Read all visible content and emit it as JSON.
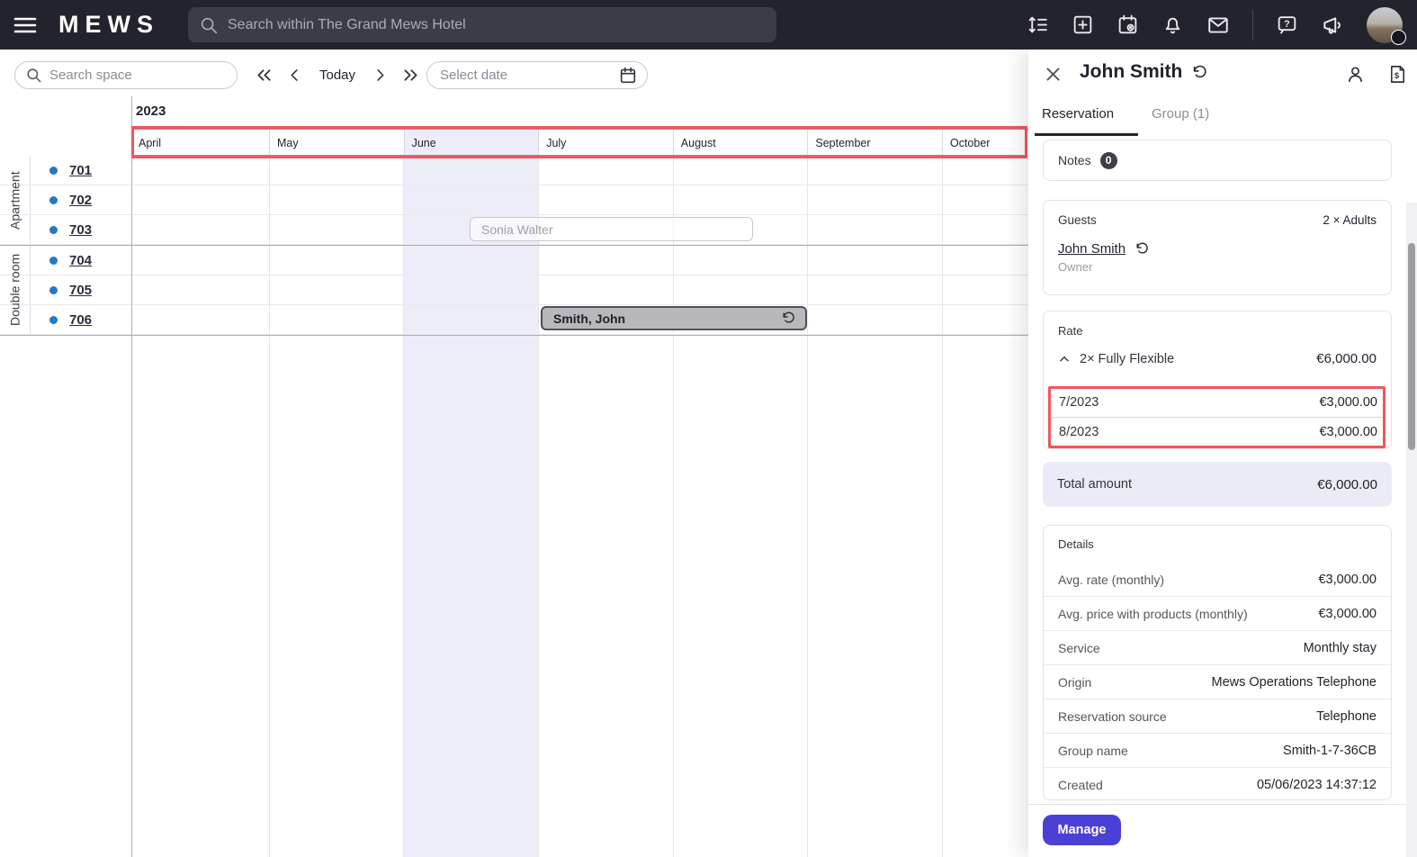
{
  "topbar": {
    "logo": "MEWS",
    "search_placeholder": "Search within The Grand Mews Hotel"
  },
  "toolbar": {
    "search_space_placeholder": "Search space",
    "today_label": "Today",
    "select_date_placeholder": "Select date"
  },
  "timeline": {
    "year": "2023",
    "months": [
      {
        "label": "April"
      },
      {
        "label": "May"
      },
      {
        "label": "June"
      },
      {
        "label": "July"
      },
      {
        "label": "August"
      },
      {
        "label": "September"
      },
      {
        "label": "October"
      }
    ],
    "groups": [
      {
        "label": "Apartment",
        "rooms": [
          {
            "number": "701"
          },
          {
            "number": "702"
          },
          {
            "number": "703"
          }
        ]
      },
      {
        "label": "Double room",
        "rooms": [
          {
            "number": "704"
          },
          {
            "number": "705"
          },
          {
            "number": "706"
          }
        ]
      }
    ],
    "reservations": [
      {
        "name": "Sonia Walter",
        "state": "ghost"
      },
      {
        "name": "Smith, John",
        "state": "selected"
      }
    ]
  },
  "panel": {
    "title": "John Smith",
    "tabs": {
      "reservation": "Reservation",
      "group": "Group (1)"
    },
    "notes": {
      "label": "Notes",
      "count": "0"
    },
    "guests": {
      "label": "Guests",
      "count_label": "2 × Adults",
      "owner_name": "John Smith",
      "owner_role": "Owner"
    },
    "rate": {
      "label": "Rate",
      "name": "2× Fully Flexible",
      "amount": "€6,000.00",
      "months": [
        {
          "period": "7/2023",
          "amount": "€3,000.00"
        },
        {
          "period": "8/2023",
          "amount": "€3,000.00"
        }
      ],
      "total_label": "Total amount",
      "total_amount": "€6,000.00"
    },
    "details": {
      "label": "Details",
      "rows": [
        {
          "label": "Avg. rate (monthly)",
          "value": "€3,000.00"
        },
        {
          "label": "Avg. price with products (monthly)",
          "value": "€3,000.00"
        },
        {
          "label": "Service",
          "value": "Monthly stay"
        },
        {
          "label": "Origin",
          "value": "Mews Operations Telephone"
        },
        {
          "label": "Reservation source",
          "value": "Telephone"
        },
        {
          "label": "Group name",
          "value": "Smith-1-7-36CB"
        },
        {
          "label": "Created",
          "value": "05/06/2023 14:37:12"
        }
      ]
    },
    "manage_label": "Manage"
  },
  "colors": {
    "topbar_bg": "#23232E",
    "accent_red": "#F2555C",
    "primary_button": "#4A3FD6",
    "current_month_highlight": "#EDEDFA",
    "room_dot_blue": "#2579BE"
  }
}
